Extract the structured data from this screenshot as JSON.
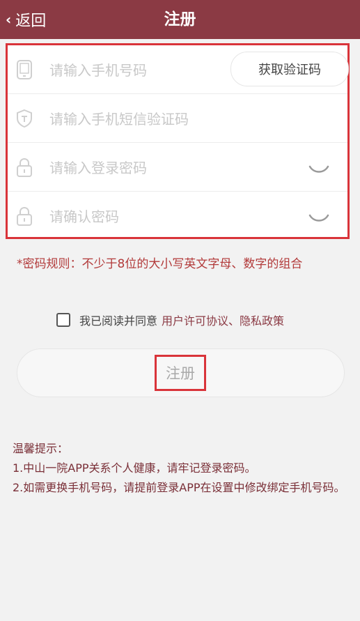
{
  "header": {
    "back_label": "返回",
    "title": "注册"
  },
  "form": {
    "phone_placeholder": "请输入手机号码",
    "get_code_label": "获取验证码",
    "sms_placeholder": "请输入手机短信验证码",
    "password_placeholder": "请输入登录密码",
    "confirm_placeholder": "请确认密码"
  },
  "rule_text": "*密码规则：不少于8位的大小写英文字母、数字的组合",
  "agreement": {
    "prefix": "我已阅读并同意",
    "link": "用户许可协议、隐私政策",
    "checked": false
  },
  "submit_label": "注册",
  "tips": {
    "title": "温馨提示：",
    "line1": "1.中山一院APP关系个人健康，请牢记登录密码。",
    "line2": "2.如需更换手机号码，请提前登录APP在设置中修改绑定手机号码。"
  },
  "colors": {
    "header": "#8b3a44",
    "highlight_border": "#d9343a",
    "rule_text": "#b23a3a",
    "tips_text": "#7a2f37"
  }
}
